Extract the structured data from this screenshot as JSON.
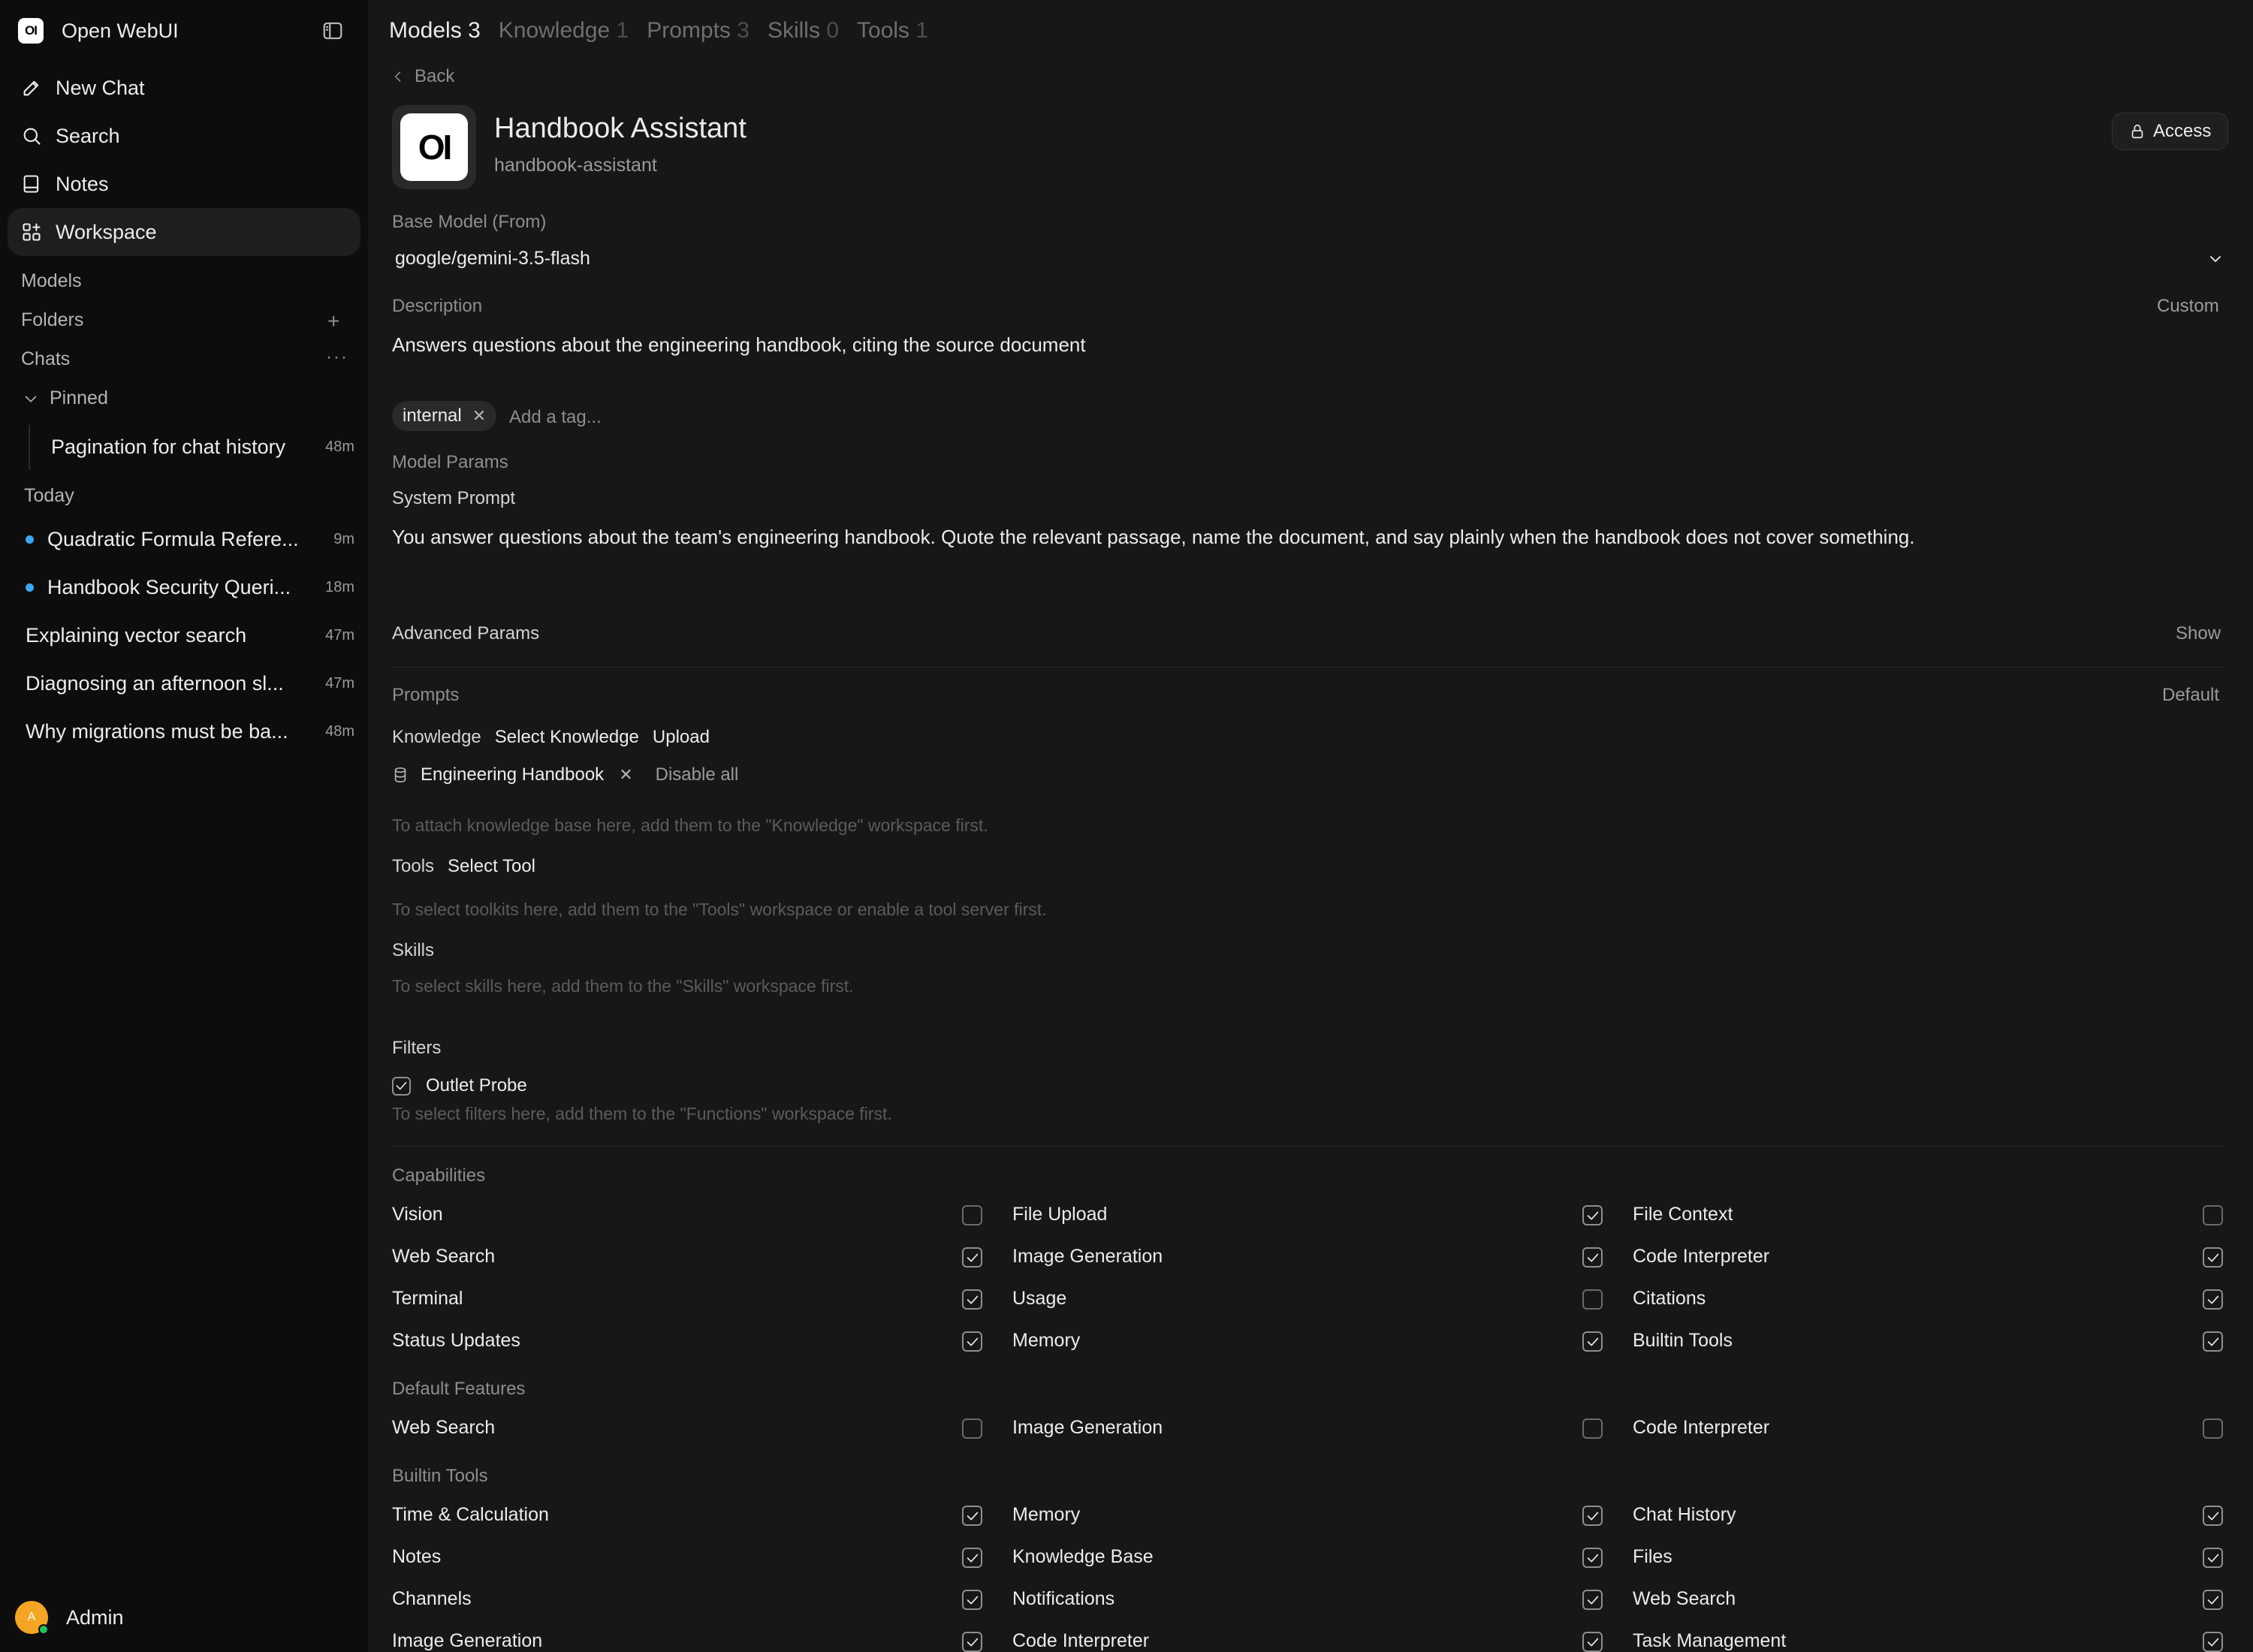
{
  "app": {
    "title": "Open WebUI",
    "logo": "OI"
  },
  "sidebar": {
    "nav": [
      {
        "label": "New Chat",
        "icon": "pencil-icon"
      },
      {
        "label": "Search",
        "icon": "search-icon"
      },
      {
        "label": "Notes",
        "icon": "notebook-icon"
      },
      {
        "label": "Workspace",
        "icon": "grid-icon"
      }
    ],
    "sections": {
      "models": "Models",
      "folders": "Folders",
      "chats": "Chats",
      "pinned": "Pinned",
      "today": "Today"
    },
    "pinned_chats": [
      {
        "title": "Pagination for chat history",
        "time": "48m"
      }
    ],
    "today_chats": [
      {
        "title": "Quadratic Formula Refere...",
        "time": "9m",
        "unread": true
      },
      {
        "title": "Handbook Security Queri...",
        "time": "18m",
        "unread": true
      },
      {
        "title": "Explaining vector search",
        "time": "47m",
        "unread": false
      },
      {
        "title": "Diagnosing an afternoon sl...",
        "time": "47m",
        "unread": false
      },
      {
        "title": "Why migrations must be ba...",
        "time": "48m",
        "unread": false
      }
    ],
    "user": {
      "name": "Admin",
      "initial": "A"
    }
  },
  "tabs": [
    {
      "label": "Models",
      "count": "3"
    },
    {
      "label": "Knowledge",
      "count": "1"
    },
    {
      "label": "Prompts",
      "count": "3"
    },
    {
      "label": "Skills",
      "count": "0"
    },
    {
      "label": "Tools",
      "count": "1"
    }
  ],
  "editor": {
    "back": "Back",
    "access": "Access",
    "avatar": "OI",
    "name": "Handbook Assistant",
    "id": "handbook-assistant",
    "base_model_label": "Base Model (From)",
    "base_model": "google/gemini-3.5-flash",
    "description_label": "Description",
    "description_mode": "Custom",
    "description": "Answers questions about the engineering handbook, citing the source document",
    "tags": [
      "internal"
    ],
    "tag_placeholder": "Add a tag...",
    "model_params_label": "Model Params",
    "system_prompt_label": "System Prompt",
    "system_prompt": "You answer questions about the team's engineering handbook. Quote the relevant passage, name the document, and say plainly when the handbook does not cover something.",
    "advanced_label": "Advanced Params",
    "advanced_toggle": "Show",
    "prompts_label": "Prompts",
    "prompts_value": "Default",
    "knowledge_label": "Knowledge",
    "select_knowledge": "Select Knowledge",
    "upload": "Upload",
    "knowledge_item": "Engineering Handbook",
    "disable_all": "Disable all",
    "knowledge_hint": "To attach knowledge base here, add them to the \"Knowledge\" workspace first.",
    "tools_label": "Tools",
    "select_tool": "Select Tool",
    "tools_hint": "To select toolkits here, add them to the \"Tools\" workspace or enable a tool server first.",
    "skills_label": "Skills",
    "skills_hint": "To select skills here, add them to the \"Skills\" workspace first.",
    "filters_label": "Filters",
    "filter_item": "Outlet Probe",
    "filters_hint": "To select filters here, add them to the \"Functions\" workspace first."
  },
  "capabilities": {
    "label": "Capabilities",
    "items": [
      {
        "label": "Vision",
        "checked": false
      },
      {
        "label": "File Upload",
        "checked": true
      },
      {
        "label": "File Context",
        "checked": false
      },
      {
        "label": "Web Search",
        "checked": true
      },
      {
        "label": "Image Generation",
        "checked": true
      },
      {
        "label": "Code Interpreter",
        "checked": true
      },
      {
        "label": "Terminal",
        "checked": true
      },
      {
        "label": "Usage",
        "checked": false
      },
      {
        "label": "Citations",
        "checked": true
      },
      {
        "label": "Status Updates",
        "checked": true
      },
      {
        "label": "Memory",
        "checked": true
      },
      {
        "label": "Builtin Tools",
        "checked": true
      }
    ]
  },
  "default_features": {
    "label": "Default Features",
    "items": [
      {
        "label": "Web Search",
        "checked": false
      },
      {
        "label": "Image Generation",
        "checked": false
      },
      {
        "label": "Code Interpreter",
        "checked": false
      }
    ]
  },
  "builtin_tools": {
    "label": "Builtin Tools",
    "items": [
      {
        "label": "Time & Calculation",
        "checked": true
      },
      {
        "label": "Memory",
        "checked": true
      },
      {
        "label": "Chat History",
        "checked": true
      },
      {
        "label": "Notes",
        "checked": true
      },
      {
        "label": "Knowledge Base",
        "checked": true
      },
      {
        "label": "Files",
        "checked": true
      },
      {
        "label": "Channels",
        "checked": true
      },
      {
        "label": "Notifications",
        "checked": true
      },
      {
        "label": "Web Search",
        "checked": true
      },
      {
        "label": "Image Generation",
        "checked": true
      },
      {
        "label": "Code Interpreter",
        "checked": true
      },
      {
        "label": "Task Management",
        "checked": true
      }
    ]
  }
}
